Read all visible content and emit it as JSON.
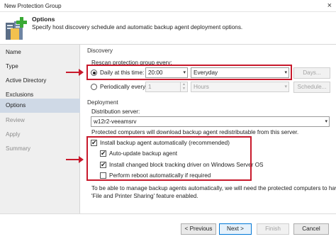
{
  "window": {
    "title": "New Protection Group"
  },
  "header": {
    "title": "Options",
    "description": "Specify host discovery schedule and automatic backup agent deployment options."
  },
  "nav": [
    {
      "label": "Name",
      "state": "normal"
    },
    {
      "label": "Type",
      "state": "normal"
    },
    {
      "label": "Active Directory",
      "state": "normal"
    },
    {
      "label": "Exclusions",
      "state": "normal"
    },
    {
      "label": "Credentials",
      "state": "normal"
    },
    {
      "label": "Options",
      "state": "active"
    },
    {
      "label": "Review",
      "state": "disabled"
    },
    {
      "label": "Apply",
      "state": "disabled"
    },
    {
      "label": "Summary",
      "state": "disabled"
    }
  ],
  "discovery": {
    "group_label": "Discovery",
    "rescan_label": "Rescan protection group every:",
    "daily": {
      "label": "Daily at this time:",
      "selected": true,
      "time": "20:00",
      "frequency": "Everyday",
      "days_button": "Days..."
    },
    "periodic": {
      "label": "Periodically every:",
      "selected": false,
      "value": "1",
      "unit": "Hours",
      "schedule_button": "Schedule..."
    }
  },
  "deployment": {
    "group_label": "Deployment",
    "server_label": "Distribution server:",
    "server_value": "w12r2-veeamsrv",
    "server_note": "Protected computers will download backup agent redistributable from this server.",
    "install_auto": {
      "label": "Install backup agent automatically (recommended)",
      "checked": true
    },
    "auto_update": {
      "label": "Auto-update backup agent",
      "checked": true
    },
    "install_cbt": {
      "label": "Install changed block tracking driver on Windows Server OS",
      "checked": true
    },
    "reboot": {
      "label": "Perform reboot automatically if required",
      "checked": false
    },
    "info_line1": "To be able to manage backup agents automatically, we will need the protected computers to have",
    "info_line2": "'File and Printer Sharing' feature enabled."
  },
  "footer": {
    "previous": "< Previous",
    "next": "Next >",
    "finish": "Finish",
    "cancel": "Cancel"
  },
  "colors": {
    "annotation": "#c8192c",
    "nav_active": "#cfd9e6",
    "sidebar": "#efefef"
  },
  "icons": {
    "close": "×",
    "dropdown": "▾",
    "check": "✔"
  }
}
